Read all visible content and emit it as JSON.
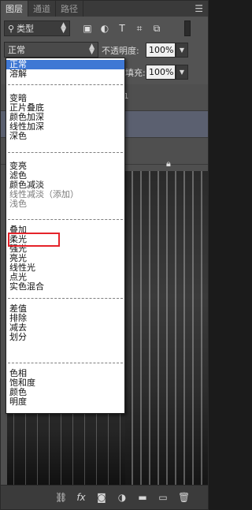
{
  "tabs": [
    {
      "label": "图层",
      "active": true
    },
    {
      "label": "通道",
      "active": false
    },
    {
      "label": "路径",
      "active": false
    }
  ],
  "panel_menu_icon": "panel-menu-icon",
  "filter": {
    "kind_label": "类型",
    "icons": [
      "image-filter-icon",
      "adjustment-filter-icon",
      "type-filter-icon",
      "shape-filter-icon",
      "smartobject-filter-icon"
    ]
  },
  "blend": {
    "current_mode": "正常",
    "opacity_label": "不透明度:",
    "opacity_value": "100%",
    "fill_label": "填充:",
    "fill_value": "100%"
  },
  "layers": {
    "visible_fragment": "1"
  },
  "dropdown": {
    "groups": [
      [
        "正常",
        "溶解"
      ],
      [
        "变暗",
        "正片叠底",
        "颜色加深",
        "线性加深",
        "深色"
      ],
      [
        "变亮",
        "滤色",
        "颜色减淡",
        "线性减淡（添加）",
        "浅色"
      ],
      [
        "叠加",
        "柔光",
        "强光",
        "亮光",
        "线性光",
        "点光",
        "实色混合"
      ],
      [
        "差值",
        "排除",
        "减去",
        "划分"
      ],
      [
        "色相",
        "饱和度",
        "颜色",
        "明度"
      ]
    ],
    "selected": "正常",
    "dimmed": [
      "线性减淡（添加）",
      "浅色"
    ],
    "highlighted": "柔光"
  },
  "footer_icons": [
    "link-layers-icon",
    "fx-icon",
    "mask-icon",
    "adjustment-layer-icon",
    "group-folder-icon",
    "new-layer-icon",
    "trash-icon"
  ],
  "colors": {
    "selection": "#3f78d4",
    "highlight_box": "#e5232a",
    "panel_bg": "#535353"
  }
}
